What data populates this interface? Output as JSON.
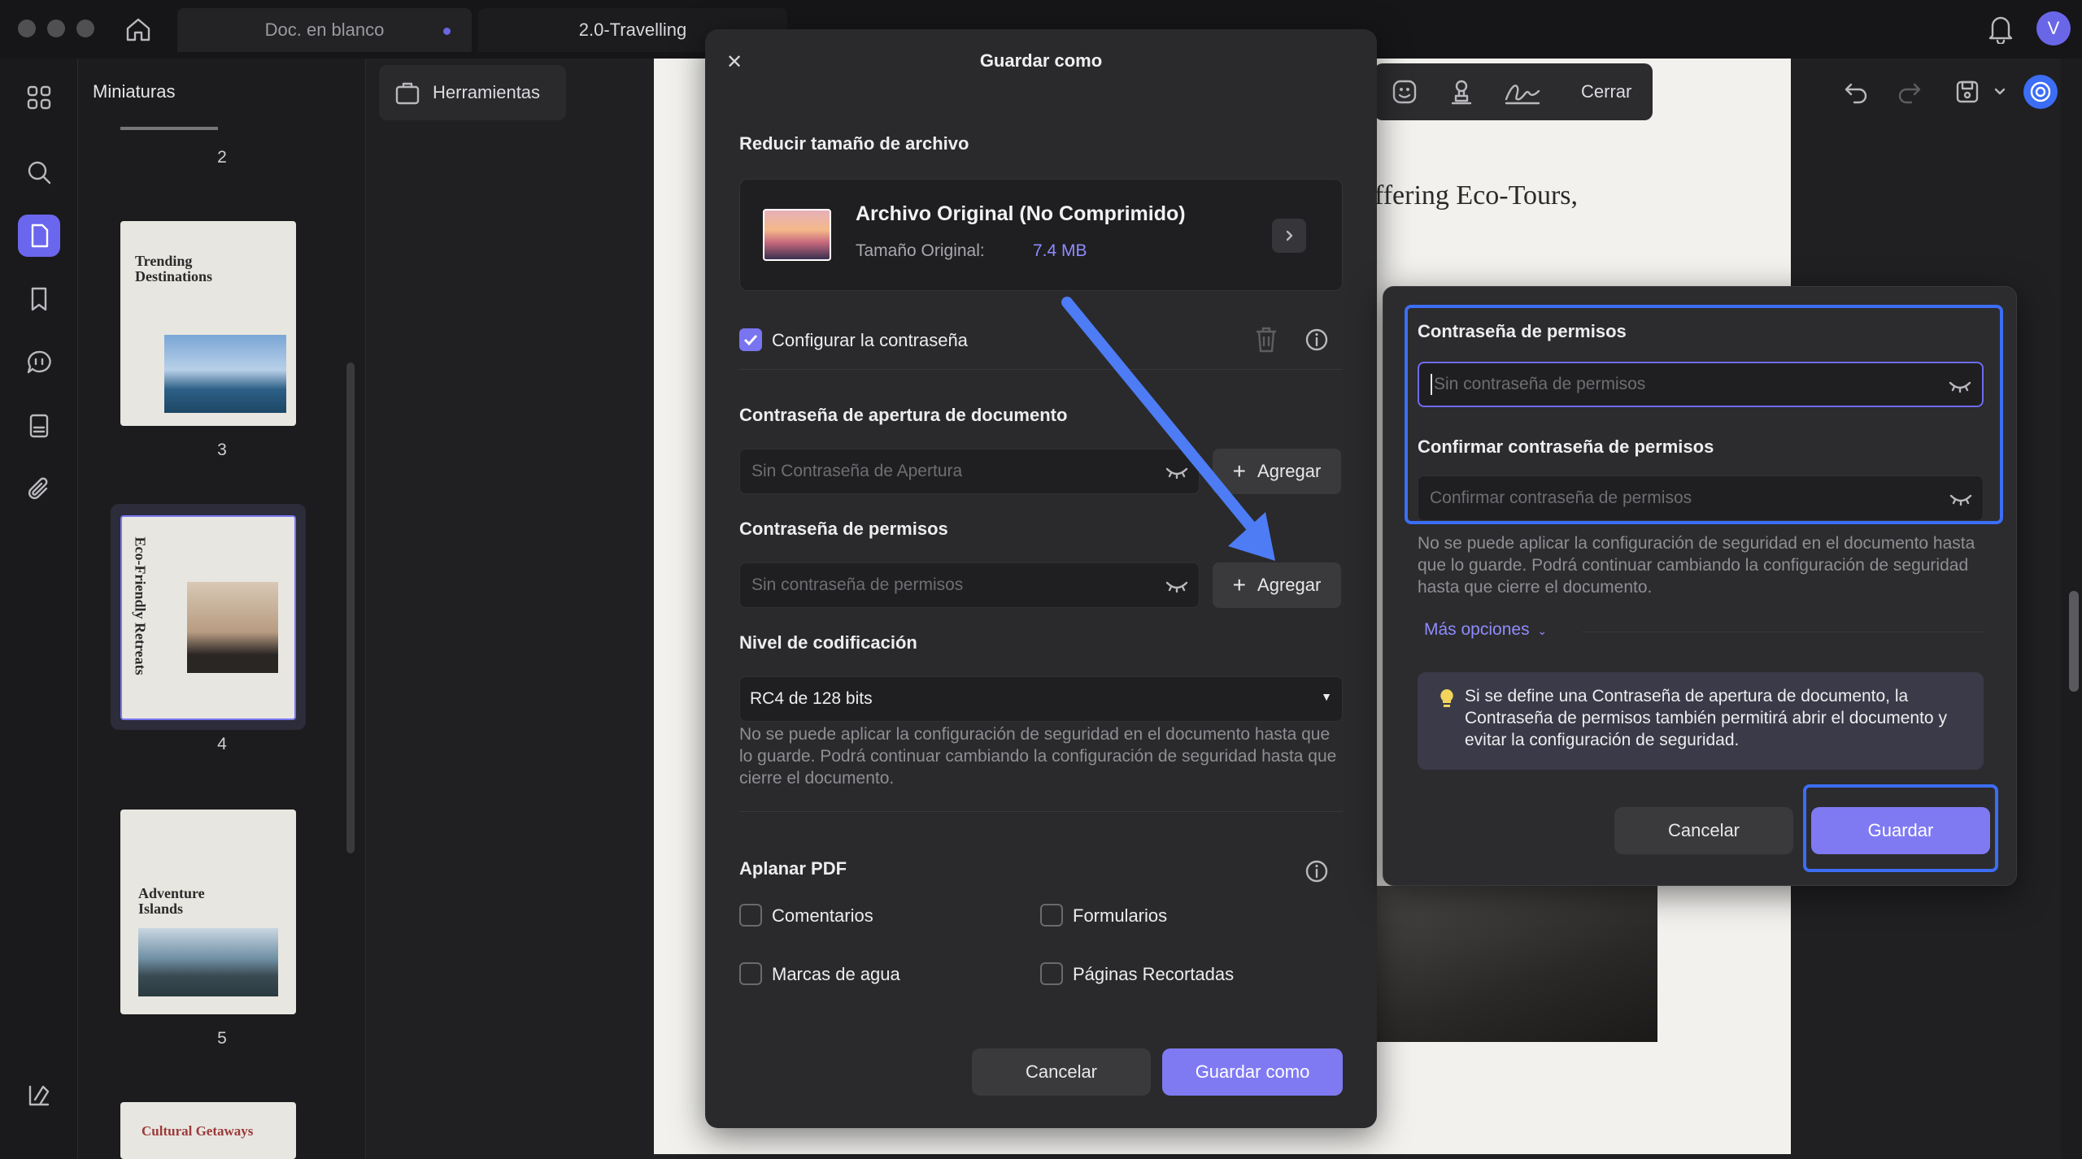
{
  "titlebar": {
    "tabs": [
      {
        "label": "Doc. en blanco"
      },
      {
        "label": "2.0-Travelling"
      }
    ],
    "user_initial": "V"
  },
  "thumbnails": {
    "title": "Miniaturas",
    "pages": [
      {
        "number": "2"
      },
      {
        "number": "3",
        "heading": "Trending Destinations"
      },
      {
        "number": "4",
        "heading": "Eco-Friendly Retreats"
      },
      {
        "number": "5",
        "heading": "Adventure Islands"
      },
      {
        "heading": "Cultural Getaways"
      }
    ]
  },
  "toolbar": {
    "tools_label": "Herramientas",
    "close_label": "Cerrar"
  },
  "document": {
    "visible_text": "ffering Eco-Tours,"
  },
  "save_dialog": {
    "title": "Guardar como",
    "reduce_section": "Reducir tamaño de archivo",
    "file_option_title": "Archivo Original (No Comprimido)",
    "file_size_label": "Tamaño Original:",
    "file_size_value": "7.4 MB",
    "set_password_label": "Configurar la contraseña",
    "open_password_label": "Contraseña de apertura de documento",
    "open_password_placeholder": "Sin Contraseña de Apertura",
    "add_label": "Agregar",
    "permissions_label": "Contraseña de permisos",
    "permissions_placeholder": "Sin contraseña de permisos",
    "encoding_label": "Nivel de codificación",
    "encoding_value": "RC4 de 128 bits",
    "security_note": "No se puede aplicar la configuración de seguridad en el documento hasta que lo guarde. Podrá continuar cambiando la configuración de seguridad hasta que cierre el documento.",
    "flatten_label": "Aplanar PDF",
    "flatten_options": [
      {
        "label": "Comentarios"
      },
      {
        "label": "Formularios"
      },
      {
        "label": "Marcas de agua"
      },
      {
        "label": "Páginas Recortadas"
      }
    ],
    "cancel_label": "Cancelar",
    "save_as_label": "Guardar como"
  },
  "permissions_popup": {
    "password_label": "Contraseña de permisos",
    "password_placeholder": "Sin contraseña de permisos",
    "confirm_label": "Confirmar contraseña de permisos",
    "confirm_placeholder": "Confirmar contraseña de permisos",
    "note": "No se puede aplicar la configuración de seguridad en el documento hasta que lo guarde. Podrá continuar cambiando la configuración de seguridad hasta que cierre el documento.",
    "more_options": "Más opciones",
    "tip": "Si se define una Contraseña de apertura de documento, la Contraseña de permisos también permitirá abrir el documento  y evitar la configuración de seguridad.",
    "cancel_label": "Cancelar",
    "save_label": "Guardar"
  },
  "colors": {
    "accent": "#7f7af2",
    "highlight": "#3c6df5"
  }
}
